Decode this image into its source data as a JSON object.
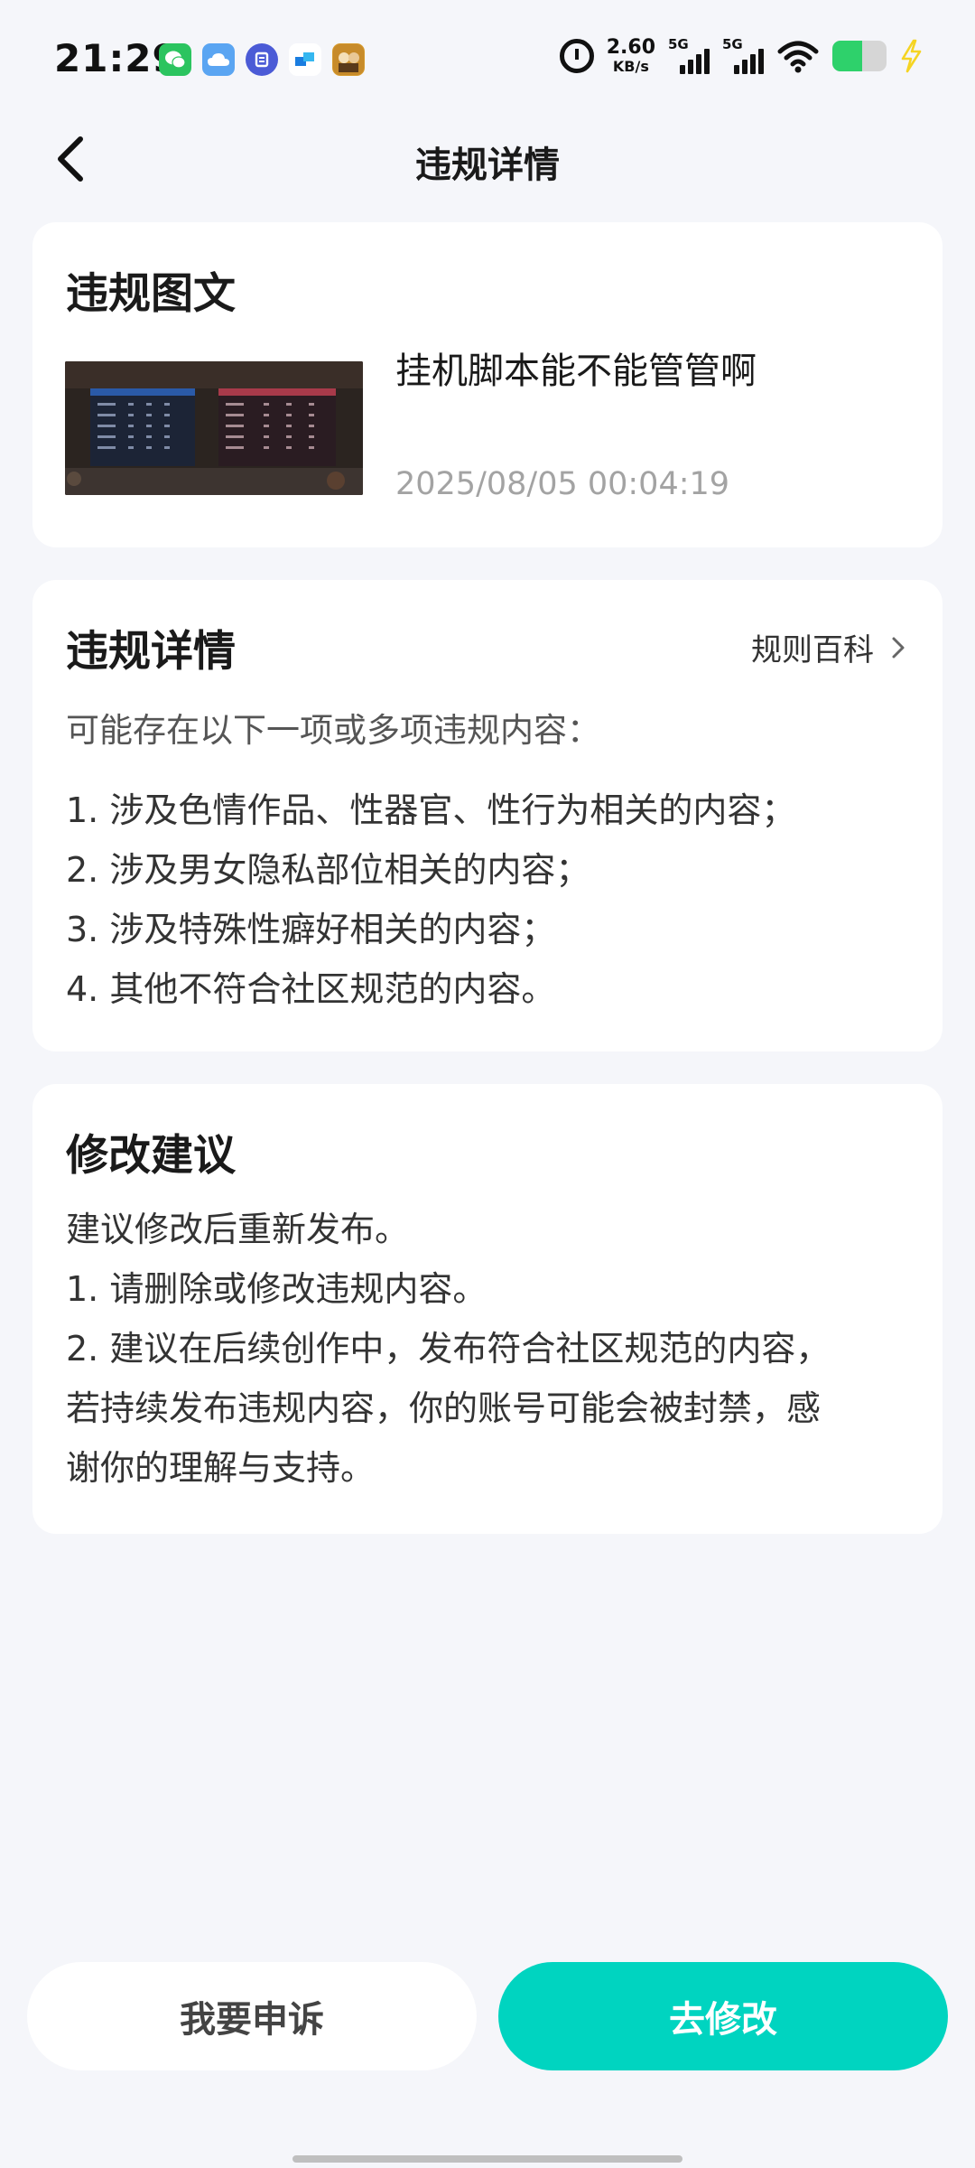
{
  "status_bar": {
    "time": "21:29",
    "net_speed_value": "2.60",
    "net_speed_unit": "KB/s",
    "sim1_label": "5G",
    "sim2_label": "5G",
    "battery_level": 0.55,
    "notification_icons": [
      "wechat-icon",
      "weather-icon",
      "tieba-icon",
      "app-icon",
      "game-icon"
    ],
    "colors": {
      "battery": "#2ed16b",
      "charging": "#f5d423"
    }
  },
  "header": {
    "title": "违规详情"
  },
  "post_card": {
    "heading": "违规图文",
    "post_text": "挂机脚本能不能管管啊",
    "post_time": "2025/08/05 00:04:19"
  },
  "detail_card": {
    "heading": "违规详情",
    "rules_link": "规则百科",
    "intro": "可能存在以下一项或多项违规内容：",
    "items": [
      "1. 涉及色情作品、性器官、性行为相关的内容；",
      "2. 涉及男女隐私部位相关的内容；",
      "3. 涉及特殊性癖好相关的内容；",
      "4. 其他不符合社区规范的内容。"
    ]
  },
  "suggest_card": {
    "heading": "修改建议",
    "lines": [
      "建议修改后重新发布。",
      "1. 请删除或修改违规内容。",
      "2. 建议在后续创作中，发布符合社区规范的内容，",
      "若持续发布违规内容，你的账号可能会被封禁，感",
      "谢你的理解与支持。"
    ]
  },
  "actions": {
    "appeal_label": "我要申诉",
    "modify_label": "去修改",
    "colors": {
      "primary": "#00d4c0"
    }
  }
}
